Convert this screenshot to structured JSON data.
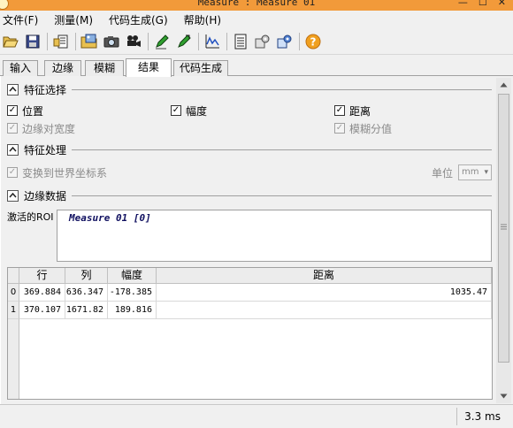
{
  "window": {
    "title": "Measure : Measure 01",
    "controls": [
      "—",
      "☐",
      "✕"
    ]
  },
  "menu": [
    {
      "label": "文件(F)"
    },
    {
      "label": "测量(M)"
    },
    {
      "label": "代码生成(G)"
    },
    {
      "label": "帮助(H)"
    }
  ],
  "tabs": [
    "输入",
    "边缘",
    "模糊",
    "结果",
    "代码生成"
  ],
  "active_tab": "结果",
  "feature_select": {
    "title": "特征选择",
    "position": "位置",
    "amplitude": "幅度",
    "distance": "距离",
    "edge_pair_width": "边缘对宽度",
    "fuzzy_score": "模糊分值"
  },
  "feature_process": {
    "title": "特征处理",
    "transform": "变换到世界坐标系",
    "unit_label": "单位",
    "unit_value": "mm",
    "unit_arrow": "▾"
  },
  "edge_data": {
    "title": "边缘数据",
    "roi_label": "激活的ROI",
    "roi_value": "Measure 01 [0]"
  },
  "table": {
    "headers": [
      "行",
      "列",
      "幅度",
      "距离"
    ],
    "rows": [
      {
        "index": "0",
        "row": "369.884",
        "col": "636.347",
        "amplitude": "-178.385",
        "distance": "1035.47"
      },
      {
        "index": "1",
        "row": "370.107",
        "col": "1671.82",
        "amplitude": "189.816",
        "distance": ""
      }
    ]
  },
  "status": {
    "time": "3.3 ms"
  },
  "colors": {
    "titlebar": "#f29a3a",
    "accent_orange": "#f0a020"
  }
}
